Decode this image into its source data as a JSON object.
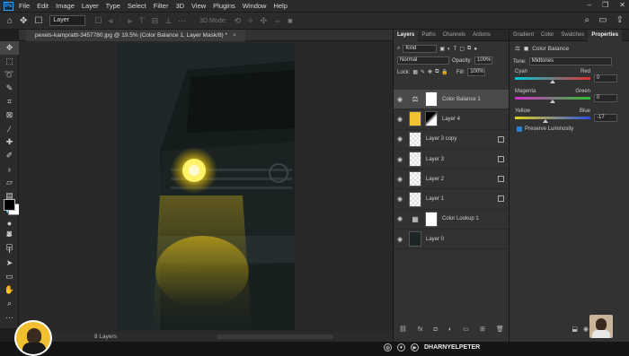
{
  "menubar": {
    "logo": "Ps",
    "items": [
      "File",
      "Edit",
      "Image",
      "Layer",
      "Type",
      "Select",
      "Filter",
      "3D",
      "View",
      "Plugins",
      "Window",
      "Help"
    ],
    "controls": [
      "–",
      "❐",
      "✕"
    ]
  },
  "options": {
    "auto_select_value": "Layer",
    "mode_3d_label": "3D Mode:"
  },
  "document": {
    "tab_title": "pexels-kamprattt-3457780.jpg @ 19.5% (Color Balance 1, Layer Mask/8) *",
    "close": "×"
  },
  "status": {
    "layers_count": "8 Layers"
  },
  "layers_panel": {
    "tabs": [
      "Layers",
      "Paths",
      "Channels",
      "Actions"
    ],
    "active_tab": "Layers",
    "filter_kind": "Kind",
    "blend_mode": "Normal",
    "opacity_label": "Opacity:",
    "opacity_value": "100%",
    "lock_label": "Lock:",
    "fill_label": "Fill:",
    "fill_value": "100%",
    "layers": [
      {
        "name": "Color Balance 1",
        "type": "adjustment",
        "selected": true
      },
      {
        "name": "Layer 4",
        "type": "pixel-mask",
        "selected": false
      },
      {
        "name": "Layer 3 copy",
        "type": "pixel",
        "selected": false
      },
      {
        "name": "Layer 3",
        "type": "pixel",
        "selected": false
      },
      {
        "name": "Layer 2",
        "type": "pixel",
        "selected": false
      },
      {
        "name": "Layer 1",
        "type": "pixel",
        "selected": false
      },
      {
        "name": "Color Lookup 1",
        "type": "adjustment-lookup",
        "selected": false
      },
      {
        "name": "Layer 0",
        "type": "photo",
        "selected": false
      }
    ],
    "footer_icons": [
      "link-icon",
      "fx-icon",
      "mask-icon",
      "adjustment-icon",
      "folder-icon",
      "new-layer-icon",
      "trash-icon"
    ]
  },
  "props_panel": {
    "tabs": [
      "Gradient",
      "Color",
      "Swatches",
      "Properties"
    ],
    "active_tab": "Properties",
    "header": "Color Balance",
    "tone_label": "Tone:",
    "tone_value": "Midtones",
    "sliders": [
      {
        "left": "Cyan",
        "right": "Red",
        "value": "0",
        "position": 0.5
      },
      {
        "left": "Magenta",
        "right": "Green",
        "value": "0",
        "position": 0.5
      },
      {
        "left": "Yellow",
        "right": "Blue",
        "value": "-17",
        "position": 0.41
      }
    ],
    "preserve_luminosity": "Preserve Luminosity"
  },
  "branding": {
    "name": "DHARNYELPETER"
  },
  "colors": {
    "accent": "#31a8ff",
    "headlight": "#f5d21a",
    "selection": "#2a81d0"
  }
}
